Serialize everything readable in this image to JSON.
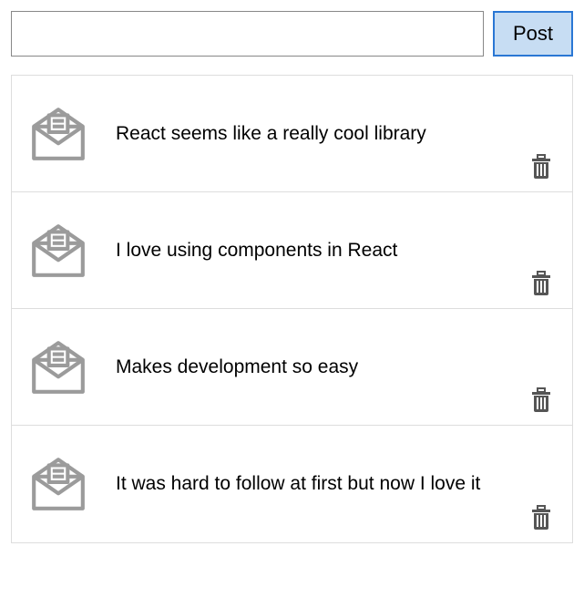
{
  "composer": {
    "input_value": "",
    "input_placeholder": "",
    "post_label": "Post"
  },
  "posts": [
    {
      "text": "React seems like a really cool library"
    },
    {
      "text": "I love using components in React"
    },
    {
      "text": "Makes development so easy"
    },
    {
      "text": "It was hard to follow at first but now I love it"
    }
  ]
}
